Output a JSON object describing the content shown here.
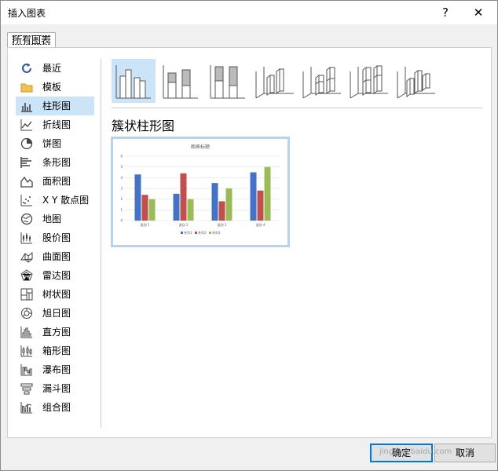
{
  "window": {
    "title": "插入图表",
    "help_button": "?",
    "close_button": "✕"
  },
  "tab": {
    "label": "所有图表"
  },
  "sidebar": {
    "items": [
      {
        "label": "最近",
        "icon": "recent-icon"
      },
      {
        "label": "模板",
        "icon": "folder-icon"
      },
      {
        "label": "柱形图",
        "icon": "column-chart-icon",
        "selected": true
      },
      {
        "label": "折线图",
        "icon": "line-chart-icon"
      },
      {
        "label": "饼图",
        "icon": "pie-chart-icon"
      },
      {
        "label": "条形图",
        "icon": "bar-chart-icon"
      },
      {
        "label": "面积图",
        "icon": "area-chart-icon"
      },
      {
        "label": "X Y 散点图",
        "icon": "scatter-chart-icon"
      },
      {
        "label": "地图",
        "icon": "map-chart-icon"
      },
      {
        "label": "股价图",
        "icon": "stock-chart-icon"
      },
      {
        "label": "曲面图",
        "icon": "surface-chart-icon"
      },
      {
        "label": "雷达图",
        "icon": "radar-chart-icon"
      },
      {
        "label": "树状图",
        "icon": "treemap-chart-icon"
      },
      {
        "label": "旭日图",
        "icon": "sunburst-chart-icon"
      },
      {
        "label": "直方图",
        "icon": "histogram-chart-icon"
      },
      {
        "label": "箱形图",
        "icon": "box-whisker-chart-icon"
      },
      {
        "label": "瀑布图",
        "icon": "waterfall-chart-icon"
      },
      {
        "label": "漏斗图",
        "icon": "funnel-chart-icon"
      },
      {
        "label": "组合图",
        "icon": "combo-chart-icon"
      }
    ]
  },
  "main": {
    "subtype_icons": [
      "clustered-column-icon",
      "stacked-column-icon",
      "100-stacked-column-icon",
      "3d-clustered-column-icon",
      "3d-stacked-column-icon",
      "3d-100-stacked-column-icon",
      "3d-column-icon"
    ],
    "heading": "簇状柱形图"
  },
  "chart_data": {
    "type": "bar",
    "title": "图表标题",
    "categories": [
      "类别 1",
      "类别 2",
      "类别 3",
      "类别 4"
    ],
    "series": [
      {
        "name": "系列1",
        "values": [
          4.3,
          2.5,
          3.5,
          4.5
        ],
        "color": "#4472c4"
      },
      {
        "name": "系列2",
        "values": [
          2.4,
          4.4,
          1.8,
          2.8
        ],
        "color": "#c0504d"
      },
      {
        "name": "系列3",
        "values": [
          2.0,
          2.0,
          3.0,
          5.0
        ],
        "color": "#9bbb59"
      }
    ],
    "yticks": [
      "0",
      "1",
      "2",
      "3",
      "4",
      "5",
      "6"
    ],
    "ylim": [
      0,
      6
    ],
    "legend_position": "bottom",
    "grid": true
  },
  "buttons": {
    "ok": "确定",
    "cancel": "取消"
  },
  "watermark": "jingyan.baidu.com",
  "colors": {
    "selection": "#cce4f7",
    "accent": "#0078d7"
  }
}
